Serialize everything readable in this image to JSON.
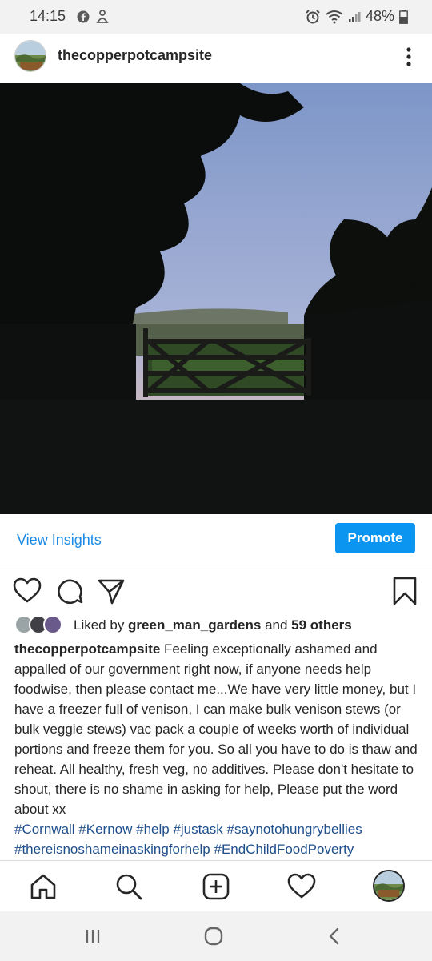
{
  "status_bar": {
    "time": "14:15",
    "battery": "48%",
    "icons": [
      "facebook-icon",
      "notification-icon",
      "alarm-icon",
      "wifi-icon",
      "signal-icon",
      "battery-icon"
    ]
  },
  "post": {
    "username": "thecopperpotcampsite",
    "insights_label": "View Insights",
    "promote_label": "Promote",
    "likes": {
      "prefix": "Liked by ",
      "user": "green_man_gardens",
      "middle": " and ",
      "others": "59 others"
    },
    "caption": {
      "author": "thecopperpotcampsite",
      "text": " Feeling exceptionally ashamed and appalled of our government right now, if anyone needs help foodwise, then please contact me...We have very little money, but I have a freezer full of venison, I can make bulk venison stews (or bulk veggie stews) vac pack a couple of weeks worth of individual portions and freeze them for you. So all you have to do is thaw and reheat. All healthy, fresh veg, no additives. Please don't hesitate to shout, there is no shame in asking for help, Please put the word about xx",
      "hashtags": "#Cornwall #Kernow #help #justask #saynotohungrybellies #thereisnoshameinaskingforhelp #EndChildFoodPoverty"
    }
  },
  "bottom_nav": [
    "home-icon",
    "search-icon",
    "new-post-icon",
    "activity-icon",
    "profile-avatar"
  ],
  "system_nav": [
    "recents-icon",
    "home-button-icon",
    "back-icon"
  ],
  "colors": {
    "accent": "#0b95f0",
    "link": "#1a8ae6",
    "hashtag": "#1e4f8c"
  }
}
